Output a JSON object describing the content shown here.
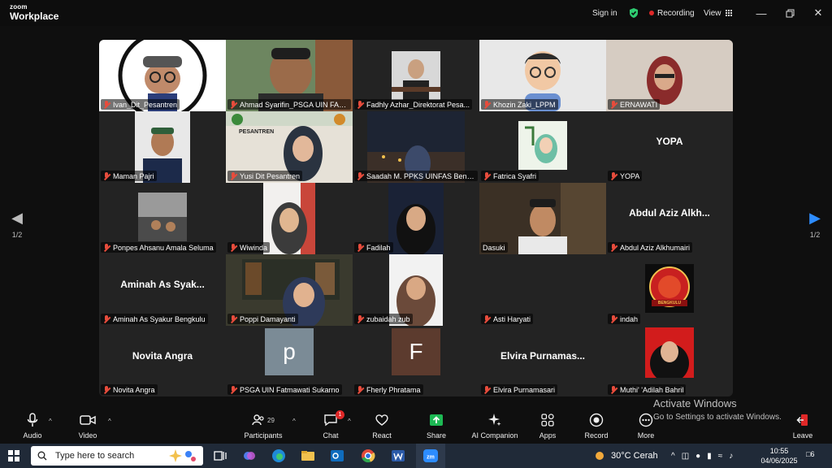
{
  "app": {
    "brand_line1": "zoom",
    "brand_line2": "Workplace"
  },
  "titlebar": {
    "signin": "Sign in",
    "recording": "Recording",
    "view": "View",
    "shield_color": "#2ecc71",
    "recording_color": "#e02828"
  },
  "gallery": {
    "page_left": "1/2",
    "page_right": "1/2",
    "tiles": [
      {
        "name": "Ivan_Dit_Pesantren",
        "muted": true
      },
      {
        "name": "Ahmad Syarifin_PSGA UIN FAS Be...",
        "muted": true,
        "active": true
      },
      {
        "name": "Fadhly Azhar_Direktorat Pesa...",
        "muted": true
      },
      {
        "name": "Khozin Zaki_LPPM",
        "muted": true
      },
      {
        "name": "ERNAWATI",
        "muted": true
      },
      {
        "name": "Maman Pajri",
        "muted": true
      },
      {
        "name": "Yusi Dit Pesantren",
        "muted": true
      },
      {
        "name": "Saadah M. PPKS UINFAS Beng...",
        "muted": true
      },
      {
        "name": "Fatrica Syafri",
        "muted": true
      },
      {
        "name": "YOPA",
        "muted": true,
        "big": "YOPA"
      },
      {
        "name": "Ponpes Ahsanu Amala Seluma",
        "muted": true
      },
      {
        "name": "Wiwinda",
        "muted": true
      },
      {
        "name": "Fadilah",
        "muted": true
      },
      {
        "name": "Dasuki",
        "muted": false
      },
      {
        "name": "Abdul Aziz Alkhumairi",
        "muted": true,
        "big": "Abdul Aziz Alkh..."
      },
      {
        "name": "Aminah As Syakur Bengkulu",
        "muted": true,
        "big": "Aminah As Syak..."
      },
      {
        "name": "Poppi Damayanti",
        "muted": true
      },
      {
        "name": "zubaidah zub",
        "muted": true
      },
      {
        "name": "Asti Haryati",
        "muted": true
      },
      {
        "name": "indah",
        "muted": true
      },
      {
        "name": "Novita Angra",
        "muted": true,
        "big": "Novita Angra"
      },
      {
        "name": "PSGA UIN Fatmawati Sukarno",
        "muted": true,
        "letter": "p"
      },
      {
        "name": "Fherly Phratama",
        "muted": true,
        "letter": "F"
      },
      {
        "name": "Elvira Purnamasari",
        "muted": true,
        "big": "Elvira Purnamas..."
      },
      {
        "name": "Muthi' 'Adilah Bahril",
        "muted": true
      }
    ],
    "tile_misc": {
      "pesantren_banner": "PESANTREN",
      "indah_logo": "BENGKULU"
    }
  },
  "toolbar": {
    "audio": "Audio",
    "video": "Video",
    "participants": "Participants",
    "participants_count": "29",
    "chat": "Chat",
    "chat_badge": "1",
    "react": "React",
    "share": "Share",
    "ai": "AI Companion",
    "apps": "Apps",
    "record": "Record",
    "more": "More",
    "leave": "Leave",
    "share_color": "#1db954",
    "leave_color": "#e02828"
  },
  "watermark": {
    "line1": "Activate Windows",
    "line2": "Go to Settings to activate Windows."
  },
  "taskbar": {
    "search_placeholder": "Type here to search",
    "weather": "30°C  Cerah",
    "time": "10:55",
    "date": "04/06/2025",
    "notif": "6"
  }
}
